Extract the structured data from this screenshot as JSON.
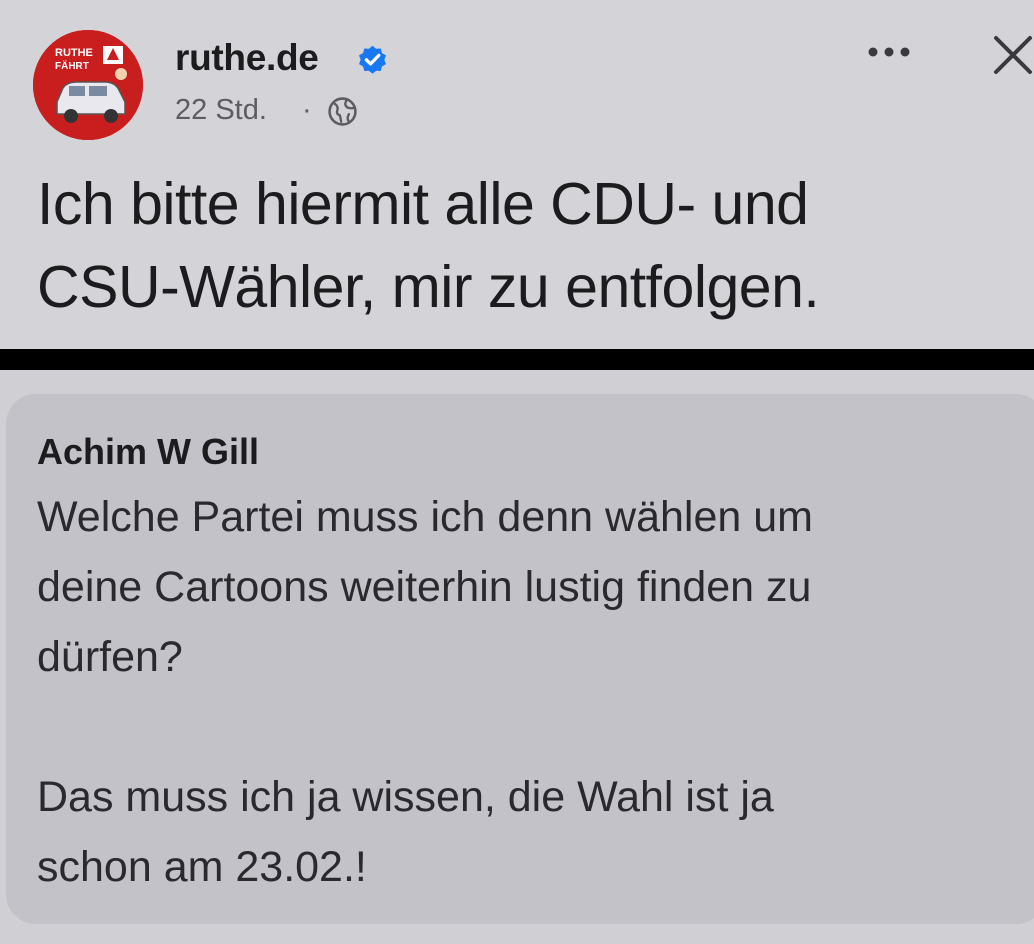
{
  "post": {
    "author": "ruthe.de",
    "avatar_text_line1": "RUTHE",
    "avatar_text_line2": "FÄHRT",
    "time": "22 Std.",
    "separator": "·",
    "text_line1": "Ich bitte hiermit alle CDU- und",
    "text_line2": "CSU-Wähler, mir zu entfolgen.",
    "icons": {
      "verified": "verified-badge-icon",
      "audience": "globe-icon",
      "more": "more-options-icon",
      "close": "close-icon"
    }
  },
  "comment": {
    "author": "Achim W Gill",
    "line1": "Welche Partei muss ich denn wählen um",
    "line2": "deine Cartoons weiterhin lustig finden zu",
    "line3": "dürfen?",
    "line4": "Das muss ich ja wissen, die Wahl ist ja",
    "line5": "schon am 23.02.!"
  },
  "colors": {
    "verified_blue": "#1877f2",
    "avatar_red": "#c81e1e"
  }
}
